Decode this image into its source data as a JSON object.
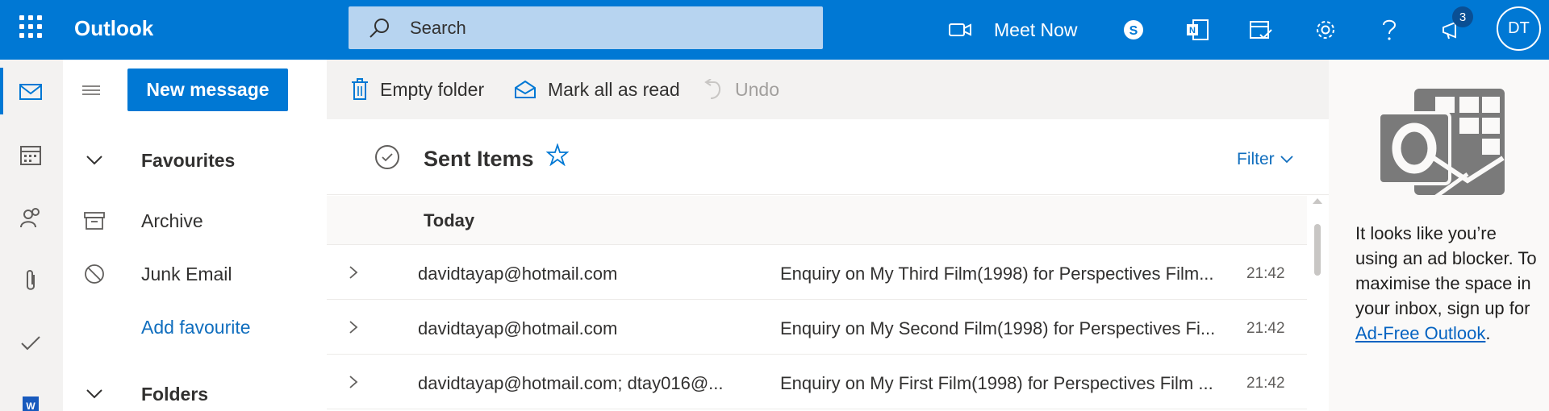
{
  "app": {
    "name": "Outlook"
  },
  "search": {
    "placeholder": "Search"
  },
  "topbar": {
    "meet_now": "Meet Now",
    "notification_count": "3",
    "avatar_initials": "DT"
  },
  "folders": {
    "new_message": "New message",
    "favourites": "Favourites",
    "archive": "Archive",
    "junk": "Junk Email",
    "add_favourite": "Add favourite",
    "folders_label": "Folders"
  },
  "commands": {
    "empty_folder": "Empty folder",
    "mark_all_read": "Mark all as read",
    "undo": "Undo"
  },
  "list": {
    "title": "Sent Items",
    "filter": "Filter",
    "group": "Today",
    "messages": [
      {
        "from": "davidtayap@hotmail.com",
        "subject": "Enquiry on My Third Film(1998) for Perspectives Film...",
        "time": "21:42"
      },
      {
        "from": "davidtayap@hotmail.com",
        "subject": "Enquiry on My Second Film(1998) for Perspectives Fi...",
        "time": "21:42"
      },
      {
        "from": "davidtayap@hotmail.com; dtay016@...",
        "subject": "Enquiry on My First Film(1998) for Perspectives Film ...",
        "time": "21:42"
      }
    ]
  },
  "ad": {
    "text": "It looks like you’re using an ad blocker. To maximise the space in your inbox, sign up for",
    "link": "Ad-Free Outlook",
    "end": "."
  },
  "colors": {
    "brand": "#0078d4",
    "link": "#106ebe"
  }
}
